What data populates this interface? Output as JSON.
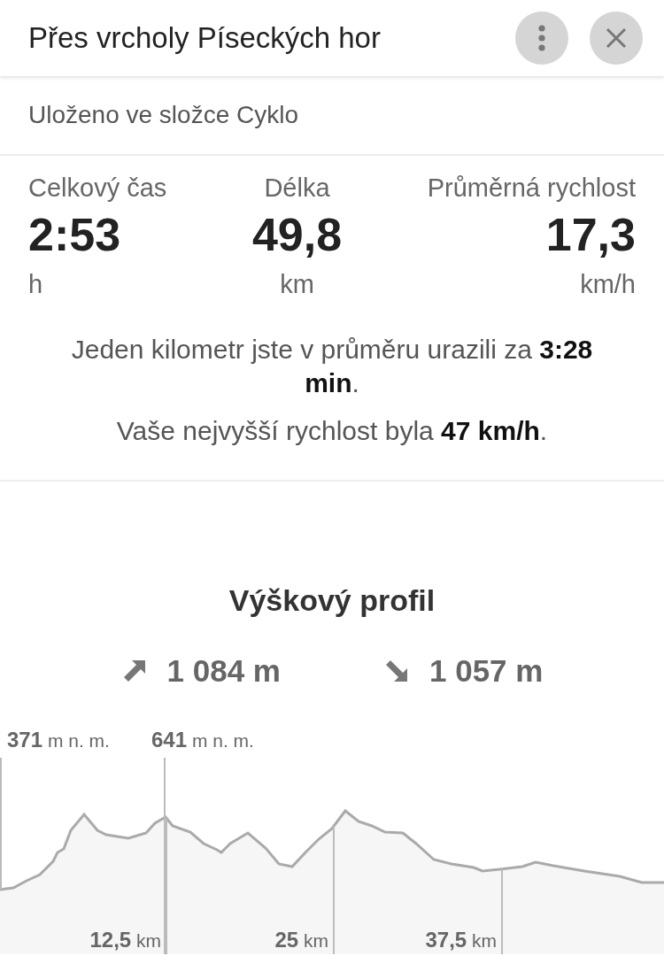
{
  "header": {
    "title": "Přes vrcholy Píseckých hor"
  },
  "folder": "Uloženo ve složce Cyklo",
  "stats": [
    {
      "label": "Celkový čas",
      "value": "2:53",
      "unit": "h"
    },
    {
      "label": "Délka",
      "value": "49,8",
      "unit": "km"
    },
    {
      "label": "Průměrná rychlost",
      "value": "17,3",
      "unit": "km/h"
    }
  ],
  "notes": [
    "Jeden kilometr jste v průměru urazili za **3:28 min**.",
    "Vaše nejvyšší rychlost byla **47 km/h**."
  ],
  "elevation": {
    "title": "Výškový profil",
    "totals": [
      {
        "kind": "ascent",
        "value": "1 084 m"
      },
      {
        "kind": "descent",
        "value": "1 057 m"
      }
    ],
    "markers": [
      {
        "value": "371",
        "unit": "m n. m."
      },
      {
        "value": "641",
        "unit": "m n. m."
      }
    ],
    "distance_ticks": [
      {
        "value": "12,5",
        "unit": "km"
      },
      {
        "value": "25",
        "unit": "km"
      },
      {
        "value": "37,5",
        "unit": "km"
      }
    ]
  }
}
